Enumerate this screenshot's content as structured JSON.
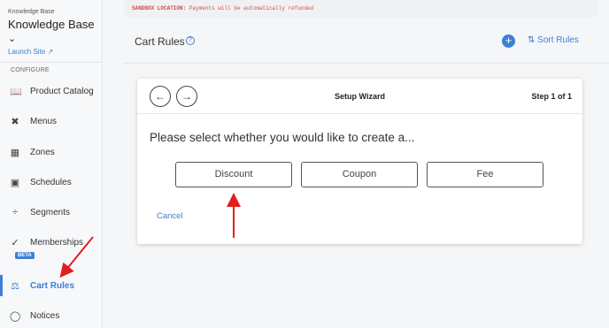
{
  "sidebar": {
    "kb_small": "Knowledge Base",
    "kb_title": "Knowledge Base",
    "launch_site": "Launch Site",
    "section_label": "CONFIGURE",
    "items": [
      {
        "label": "Product Catalog",
        "icon": "book-icon"
      },
      {
        "label": "Menus",
        "icon": "utensils-icon"
      },
      {
        "label": "Zones",
        "icon": "map-icon"
      },
      {
        "label": "Schedules",
        "icon": "calendar-icon"
      },
      {
        "label": "Segments",
        "icon": "divide-icon"
      },
      {
        "label": "Memberships",
        "icon": "check-circle-icon"
      },
      {
        "label": "Cart Rules",
        "icon": "scale-icon"
      },
      {
        "label": "Notices",
        "icon": "chat-icon"
      }
    ],
    "beta_badge": "BETA",
    "accent": "#3d7fd6"
  },
  "banner": {
    "label": "SANDBOX LOCATION:",
    "text": " Payments will be automatically refunded",
    "color": "#d64a4a"
  },
  "header": {
    "title": "Cart Rules",
    "sort_label": "Sort Rules"
  },
  "wizard": {
    "title": "Setup Wizard",
    "step": "Step 1 of 1",
    "prompt": "Please select whether you would like to create a...",
    "choices": [
      "Discount",
      "Coupon",
      "Fee"
    ],
    "cancel": "Cancel"
  }
}
